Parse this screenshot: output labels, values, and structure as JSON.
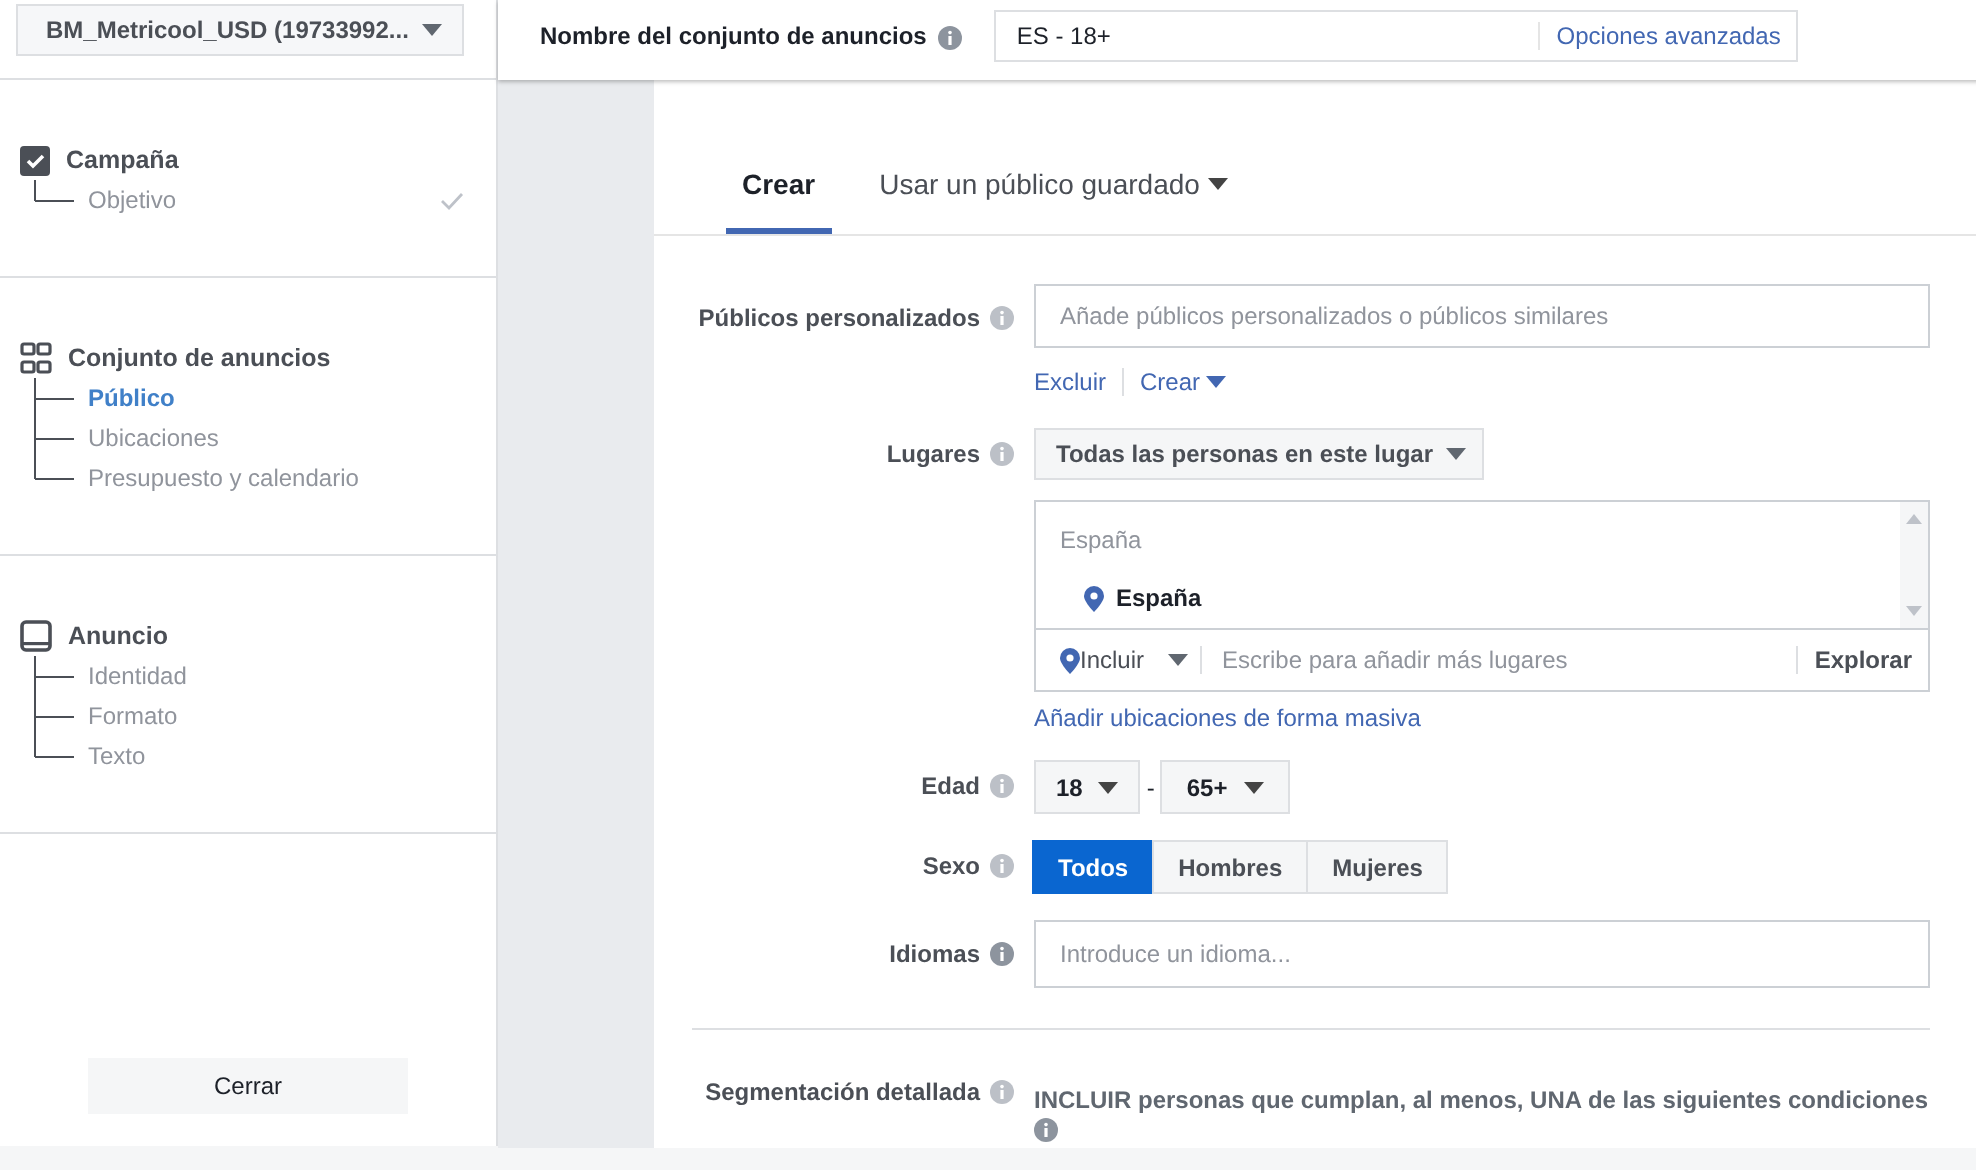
{
  "account_selector": {
    "label": "BM_Metricool_USD (19733992..."
  },
  "ad_set_name": {
    "label": "Nombre del conjunto de anuncios",
    "value": "ES - 18+",
    "link": "Opciones avanzadas"
  },
  "sidebar": {
    "sections": [
      {
        "kind": "checkbox",
        "title": "Campaña",
        "items": [
          {
            "label": "Objetivo",
            "selected": false,
            "completed": true
          }
        ]
      },
      {
        "kind": "grid",
        "title": "Conjunto de anuncios",
        "items": [
          {
            "label": "Público",
            "selected": true,
            "completed": false
          },
          {
            "label": "Ubicaciones",
            "selected": false,
            "completed": false
          },
          {
            "label": "Presupuesto y calendario",
            "selected": false,
            "completed": false
          }
        ]
      },
      {
        "kind": "tablet",
        "title": "Anuncio",
        "items": [
          {
            "label": "Identidad",
            "selected": false,
            "completed": false
          },
          {
            "label": "Formato",
            "selected": false,
            "completed": false
          },
          {
            "label": "Texto",
            "selected": false,
            "completed": false
          }
        ]
      }
    ],
    "close_button": "Cerrar"
  },
  "tabs": [
    {
      "label": "Crear",
      "selected": true,
      "dropdown": false
    },
    {
      "label": "Usar un público guardado",
      "selected": false,
      "dropdown": true
    }
  ],
  "custom_audiences": {
    "label": "Públicos personalizados",
    "placeholder": "Añade públicos personalizados o públicos similares",
    "links": [
      {
        "label": "Excluir",
        "dropdown": false
      },
      {
        "label": "Crear",
        "dropdown": true
      }
    ]
  },
  "locations": {
    "label": "Lugares",
    "mode": "Todas las personas en este lugar",
    "group": "España",
    "items": [
      "España"
    ],
    "include": "Incluir",
    "placeholder": "Escribe para añadir más lugares",
    "browse": "Explorar",
    "bulk_link": "Añadir ubicaciones de forma masiva"
  },
  "age": {
    "label": "Edad",
    "min": "18",
    "separator": "-",
    "max": "65+"
  },
  "gender": {
    "label": "Sexo",
    "options": [
      {
        "label": "Todos",
        "selected": true
      },
      {
        "label": "Hombres",
        "selected": false
      },
      {
        "label": "Mujeres",
        "selected": false
      }
    ]
  },
  "languages": {
    "label": "Idiomas",
    "placeholder": "Introduce un idioma..."
  },
  "detailed_targeting": {
    "label": "Segmentación detallada",
    "text": "INCLUIR personas que cumplan, al menos, UNA de las siguientes condiciones"
  }
}
